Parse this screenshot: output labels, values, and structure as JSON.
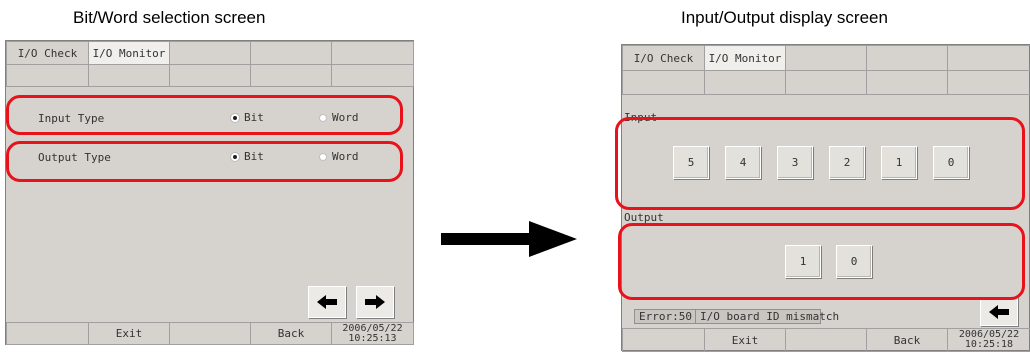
{
  "captions": {
    "left": "Bit/Word selection screen",
    "right": "Input/Output display screen"
  },
  "colors": {
    "highlight": "#e8121b",
    "panel": "#d6d3ce",
    "active_tab": "#f1efeb"
  },
  "left_screen": {
    "tabs": [
      "I/O Check",
      "I/O Monitor"
    ],
    "active_tab": "I/O Monitor",
    "input_type": {
      "label": "Input Type",
      "options": [
        "Bit",
        "Word"
      ],
      "selected": "Bit"
    },
    "output_type": {
      "label": "Output Type",
      "options": [
        "Bit",
        "Word"
      ],
      "selected": "Bit"
    },
    "nav_icons": [
      "arrow-left-icon",
      "arrow-right-icon"
    ],
    "footer": {
      "exit": "Exit",
      "back": "Back",
      "date": "2006/05/22",
      "time": "10:25:13"
    }
  },
  "right_screen": {
    "tabs": [
      "I/O Check",
      "I/O Monitor"
    ],
    "active_tab": "I/O Monitor",
    "input_label": "Input",
    "inputs": [
      "5",
      "4",
      "3",
      "2",
      "1",
      "0"
    ],
    "output_label": "Output",
    "outputs": [
      "1",
      "0"
    ],
    "status": {
      "error": "Error:50",
      "message": "I/O board ID mismatch"
    },
    "nav_icons": [
      "arrow-left-icon"
    ],
    "footer": {
      "exit": "Exit",
      "back": "Back",
      "date": "2006/05/22",
      "time": "10:25:18"
    }
  },
  "transition_icon": "arrow-right-icon"
}
